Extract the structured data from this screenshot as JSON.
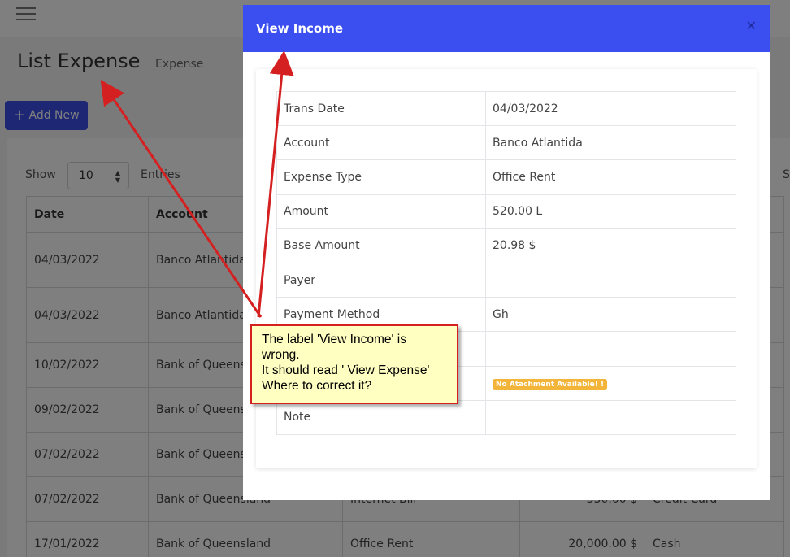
{
  "page": {
    "title": "List Expense",
    "breadcrumb": "Expense",
    "add_new_label": "Add New",
    "show_label": "Show",
    "show_value": "10",
    "entries_label": "Entries",
    "search_label_partial": "S"
  },
  "table": {
    "headers": [
      "Date",
      "Account",
      "",
      "",
      ""
    ],
    "rows": [
      {
        "date": "04/03/2022",
        "account": "Banco Atlantida",
        "type": "",
        "amount": "",
        "method": ""
      },
      {
        "date": "04/03/2022",
        "account": "Banco Atlantida",
        "type": "",
        "amount": "",
        "method": ""
      },
      {
        "date": "10/02/2022",
        "account": "Bank of Queensland",
        "type": "",
        "amount": "",
        "method": ""
      },
      {
        "date": "09/02/2022",
        "account": "Bank of Queensland",
        "type": "",
        "amount": "",
        "method": ""
      },
      {
        "date": "07/02/2022",
        "account": "Bank of Queensland",
        "type": "",
        "amount": "",
        "method": ""
      },
      {
        "date": "07/02/2022",
        "account": "Bank of Queensland",
        "type": "Internet Bill",
        "amount": "350.00 $",
        "method": "Credit Card"
      },
      {
        "date": "17/01/2022",
        "account": "Bank of Queensland",
        "type": "Office Rent",
        "amount": "20,000.00 $",
        "method": "Cash"
      }
    ]
  },
  "modal": {
    "title": "View Income",
    "close_icon": "times-icon",
    "rows": [
      {
        "label": "Trans Date",
        "value": "04/03/2022"
      },
      {
        "label": "Account",
        "value": "Banco Atlantida"
      },
      {
        "label": "Expense Type",
        "value": "Office Rent"
      },
      {
        "label": "Amount",
        "value": "520.00 L"
      },
      {
        "label": "Base Amount",
        "value": "20.98 $"
      },
      {
        "label": "Payer",
        "value": ""
      },
      {
        "label": "Payment Method",
        "value": "Gh"
      },
      {
        "label": "",
        "value": ""
      },
      {
        "label": "",
        "value": ""
      },
      {
        "label": "Note",
        "value": ""
      }
    ],
    "attachment_badge": "No Atachment Available! !"
  },
  "annotation": {
    "lines": [
      "The label 'View Income' is",
      "wrong.",
      "It should read ' View Expense'",
      "Where to correct it?"
    ]
  },
  "colors": {
    "primary": "#3b4ef0",
    "badge": "#f3b43a",
    "callout_bg": "#ffffc2",
    "callout_border": "#d42020"
  }
}
